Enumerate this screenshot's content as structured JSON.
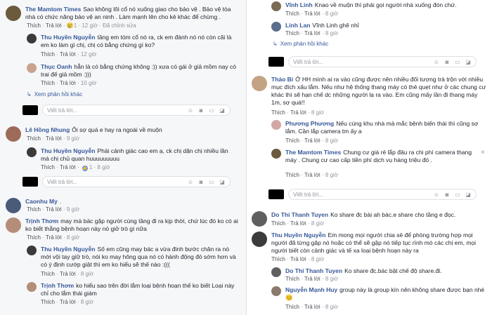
{
  "left": {
    "c1": {
      "name": "The Mamtom Times",
      "text": "Sao không lôi cổ nó xuống giao cho bảo vệ . Bảo vệ tòa nhà có chức năng bảo vệ an ninh . Làm mạnh lên cho kẻ khác để chừng .",
      "like": "Thích",
      "reply": "Trả lời",
      "emoji": "😢",
      "count": "1",
      "time": "12 giờ",
      "edited": "Đã chỉnh sửa"
    },
    "c1r1": {
      "name": "Thu Huyền Nguyễn",
      "text": "tầng em tóm cổ nó ra, ck em đánh nó nó còn cãi là em ko làm gì chị, chị có bằng chứng gì ko?",
      "like": "Thích",
      "reply": "Trả lời",
      "time": "12 giờ"
    },
    "c1r2": {
      "name": "Thục Oanh",
      "text": "hẳn là có bằng chứng không :)) xưa có gái ở giả mồm nay có trai đế giả mồm :)))",
      "like": "Thích",
      "reply": "Trả lời",
      "time": "10 giờ"
    },
    "more1": "Xem phản hồi khác",
    "reply_ph": "Viết trả lời...",
    "c2": {
      "name": "Lê Hồng Nhung",
      "text": "Ôi sợ quá e hay ra ngoài về muộn",
      "like": "Thích",
      "reply": "Trả lời",
      "time": "9 giờ"
    },
    "c2r1": {
      "name": "Thu Huyền Nguyễn",
      "text": "Phải cảnh giác cao em ạ, ck chị dặn chị nhiều lần mà chị chủ quan huuuuuuuuu",
      "like": "Thích",
      "reply": "Trả lời",
      "count": "1",
      "time": "8 giờ"
    },
    "c3": {
      "name": "Caonhu My",
      "text": ".",
      "like": "Thích",
      "reply": "Trả lời",
      "time": "9 giờ"
    },
    "c4": {
      "name": "Trịnh Thơm",
      "text": "may mà bác gặp người cùng tầng đi ra kịp thời, chứ lúc đó ko có ai ko biết thằng bệnh hoạn này nó giở trò gì nữa",
      "like": "Thích",
      "reply": "Trả lời",
      "time": "8 giờ"
    },
    "c4r1": {
      "name": "Thu Huyền Nguyễn",
      "text": "Số em cũng may bác a vừa đinh bước chân ra nó mới vội tay giữ trò, nói ko may hông qua nó có hành động đó sớm hơn và có ý định cướp giật thì em ko hiểu sẽ thế nào :(((",
      "like": "Thích",
      "reply": "Trả lời",
      "time": "8 giờ"
    },
    "c4r2": {
      "name": "Trịnh Thơm",
      "text": "ko hiểu sao trên đời lắm loại bệnh hoạn thế ko biết Loại này chỉ cho lắm thái giám",
      "like": "Thích",
      "reply": "Trả lời",
      "time": "8 giờ"
    }
  },
  "right": {
    "r1": {
      "name": "Vĩnh Linh",
      "text": "Knao về muộn thì phải gọi người nhà xuống đón chứ.",
      "like": "Thích",
      "reply": "Trả lời",
      "time": "8 giờ"
    },
    "r2": {
      "name": "Linh Lan",
      "text": "Vĩnh Linh ghê nhỉ",
      "like": "Thích",
      "reply": "Trả lời",
      "time": "8 giờ"
    },
    "more2": "Xem phản hồi khác",
    "reply_ph": "Viết trả lời...",
    "r3": {
      "name": "Thảo Bí",
      "text": "Ở HH mình ai ra vào cũng được nên nhiều đối tượng trà trộn với nhiều mục đích xấu lắm. Nếu như hệ thống thang máy có thẻ quẹt như ở các chung cư khác thì sẽ hạn chế dc những người lạ ra vào. Em cũng mấy lần đi thang máy 1m, sợ quá!!",
      "like": "Thích",
      "reply": "Trả lời",
      "time": "8 giờ"
    },
    "r3r1": {
      "name": "Phương Phương",
      "text": "Nếu cùng khu nhà mà mắc bệnh biến thái thì cũng sợ lắm. Cần lắp camera tm ấy a",
      "like": "Thích",
      "reply": "Trả lời",
      "time": "8 giờ"
    },
    "r3r2": {
      "name": "The Mamtom Times",
      "text": "Chung cư giá rẻ lắp đâu ra chi phí camera thang máy . Chung cư cao cấp tiền phí dịch vụ hàng triệu đó .",
      "like": "Thích",
      "reply": "Trả lời",
      "time": "8 giờ",
      "x": "×"
    },
    "r4": {
      "name": "Do Thi Thanh Tuyen",
      "text": "Ko share đc bài ah bác.e share cho tầng e đọc.",
      "like": "Thích",
      "reply": "Trả lời",
      "time": "8 giờ"
    },
    "r4r1": {
      "name": "Thu Huyền Nguyễn",
      "text": "Em mong mọi người chia sẻ để phòng trường hợp mọi người đã từng gặp nó hoặc có thể sẽ gặp nó tiếp tục rình mò các chị em, mọi người biết còn cảnh giác và tế xa loại bệnh hoạn này ra",
      "like": "Thích",
      "reply": "Trả lời",
      "time": "8 giờ"
    },
    "r4r2": {
      "name": "Do Thi Thanh Tuyen",
      "text": "Ko share đc.bác bật chế độ share.đi.",
      "like": "Thích",
      "reply": "Trả lời",
      "time": "8 giờ"
    },
    "r4r3": {
      "name": "Nguyễn Mạnh Huy",
      "text": "group này là group kín nên không share được bạn nhé",
      "emoji": "😊",
      "like": "Thích",
      "reply": "Trả lời",
      "time": "8 giờ"
    }
  }
}
